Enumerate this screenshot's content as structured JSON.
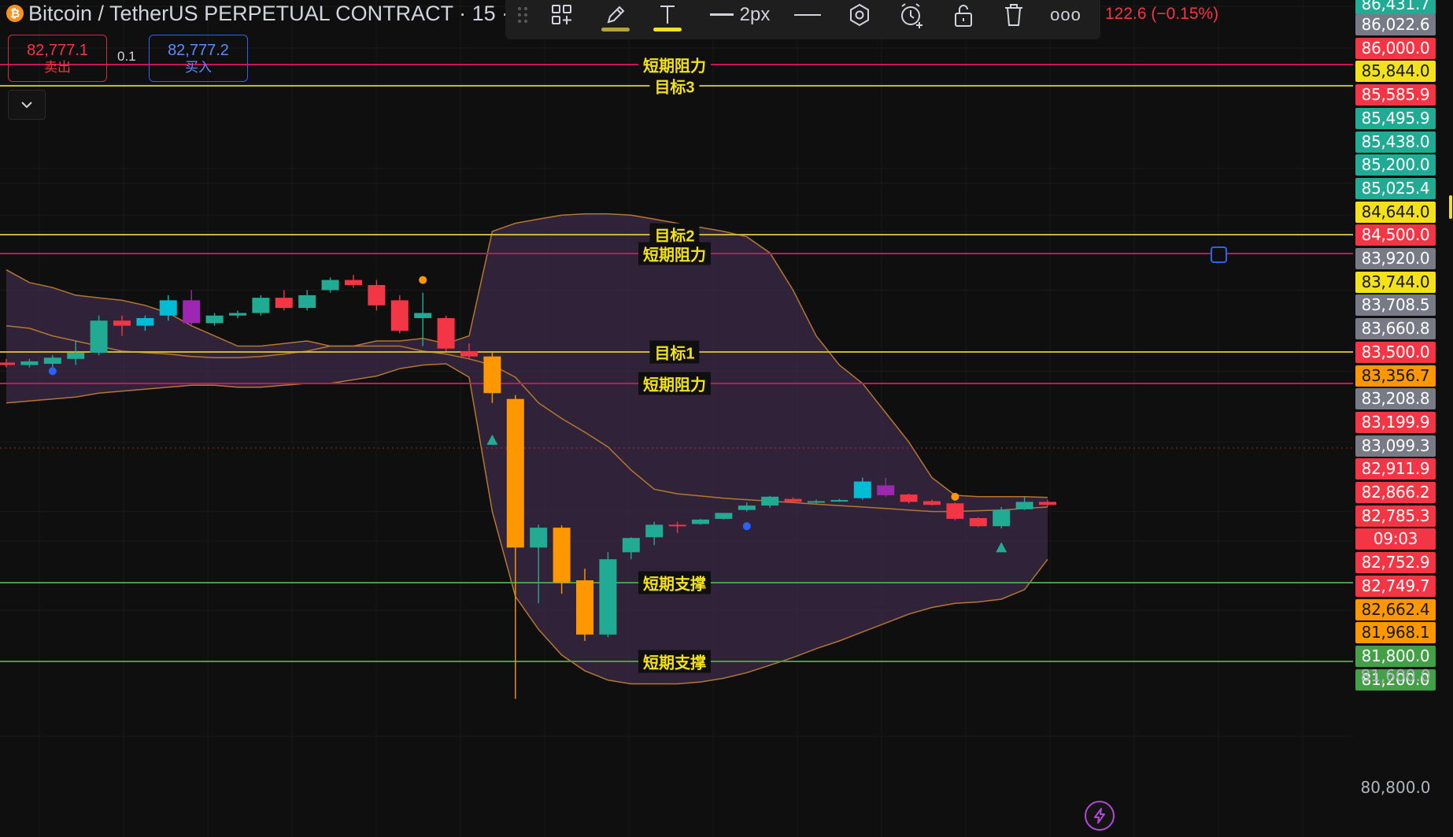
{
  "header": {
    "symbol_title": "Bitcoin / TetherUS PERPETUAL CONTRACT · 15 ·",
    "btc_glyph": "₿",
    "price_change": "122.6 (−0.15%)"
  },
  "toolbar": {
    "line_width_label": "2px",
    "more_label": "ooo",
    "tools": [
      "drag-handle-icon",
      "add-to-layout-icon",
      "pencil-icon",
      "text-icon",
      "line-width-icon",
      "line-style-icon",
      "settings-icon",
      "alert-icon",
      "lock-icon",
      "trash-icon",
      "more-icon"
    ]
  },
  "trade_panel": {
    "sell_price": "82,777.1",
    "sell_label": "卖出",
    "spread": "0.1",
    "buy_price": "82,777.2",
    "buy_label": "买入"
  },
  "colors": {
    "up": "#22ab94",
    "down": "#f23645",
    "orange": "#ff9800",
    "cyan": "#00bcd4",
    "purple": "#9c27b0",
    "band_fill": "#3d2b4a",
    "band_line": "#b5762f",
    "resistance": "#c2185b",
    "target": "#c6b43a",
    "support": "#43a047"
  },
  "levels": [
    {
      "label": "短期阻力",
      "price": 85844.0,
      "color": "#c2185b"
    },
    {
      "label": "目标3",
      "price": 85438.0,
      "color": "#c6b43a"
    },
    {
      "label": "目标2",
      "price": 83920.0,
      "color": "#c6b43a"
    },
    {
      "label": "短期阻力",
      "price": 83744.0,
      "color": "#c2185b"
    },
    {
      "label": "目标1",
      "price": 83356.7,
      "color": "#c6b43a"
    },
    {
      "label": "短期阻力",
      "price": 83099.3,
      "color": "#c2185b"
    },
    {
      "label": "短期支撑",
      "price": 81800.0,
      "color": "#43a047"
    },
    {
      "label": "短期支撑",
      "price": 81200.0,
      "color": "#43a047"
    }
  ],
  "price_axis": {
    "tags": [
      {
        "text": "86,431.7",
        "bg": "#22ab94",
        "fg": "#ffffff",
        "price": 86431.7
      },
      {
        "text": "86,022.6",
        "bg": "#787b86",
        "fg": "#ffffff",
        "price": 86022.6
      },
      {
        "text": "86,000.0",
        "bg": "#f23645",
        "fg": "#ffffff",
        "price": 86000.0
      },
      {
        "text": "85,844.0",
        "bg": "#f3e11a",
        "fg": "#131722",
        "price": 85844.0
      },
      {
        "text": "85,585.9",
        "bg": "#f23645",
        "fg": "#ffffff",
        "price": 85585.9
      },
      {
        "text": "85,495.9",
        "bg": "#22ab94",
        "fg": "#ffffff",
        "price": 85495.9
      },
      {
        "text": "85,438.0",
        "bg": "#22ab94",
        "fg": "#ffffff",
        "price": 85438.0
      },
      {
        "text": "85,200.0",
        "bg": "#22ab94",
        "fg": "#ffffff",
        "price": 85200.0
      },
      {
        "text": "85,025.4",
        "bg": "#22ab94",
        "fg": "#ffffff",
        "price": 85025.4
      },
      {
        "text": "84,644.0",
        "bg": "#f3e11a",
        "fg": "#131722",
        "price": 84644.0
      },
      {
        "text": "84,500.0",
        "bg": "#f23645",
        "fg": "#ffffff",
        "price": 84500.0
      },
      {
        "text": "83,920.0",
        "bg": "#787b86",
        "fg": "#ffffff",
        "price": 83920.0
      },
      {
        "text": "83,744.0",
        "bg": "#f3e11a",
        "fg": "#131722",
        "price": 83744.0
      },
      {
        "text": "83,708.5",
        "bg": "#787b86",
        "fg": "#ffffff",
        "price": 83708.5
      },
      {
        "text": "83,660.8",
        "bg": "#787b86",
        "fg": "#ffffff",
        "price": 83660.8
      },
      {
        "text": "83,500.0",
        "bg": "#f23645",
        "fg": "#ffffff",
        "price": 83500.0
      },
      {
        "text": "83,356.7",
        "bg": "#ff9800",
        "fg": "#131722",
        "price": 83356.7
      },
      {
        "text": "83,208.8",
        "bg": "#787b86",
        "fg": "#ffffff",
        "price": 83208.8
      },
      {
        "text": "83,199.9",
        "bg": "#f23645",
        "fg": "#ffffff",
        "price": 83199.9
      },
      {
        "text": "83,099.3",
        "bg": "#787b86",
        "fg": "#ffffff",
        "price": 83099.3
      },
      {
        "text": "82,911.9",
        "bg": "#f23645",
        "fg": "#ffffff",
        "price": 82911.9
      },
      {
        "text": "82,866.2",
        "bg": "#f23645",
        "fg": "#ffffff",
        "price": 82866.2
      },
      {
        "text": "82,785.3",
        "bg": "#f23645",
        "fg": "#ffffff",
        "price": 82785.3
      },
      {
        "text": "09:03",
        "bg": "#f23645",
        "fg": "#ffffff",
        "price": 82768.0
      },
      {
        "text": "82,752.9",
        "bg": "#f23645",
        "fg": "#ffffff",
        "price": 82752.9
      },
      {
        "text": "82,749.7",
        "bg": "#f23645",
        "fg": "#ffffff",
        "price": 82749.7
      },
      {
        "text": "82,662.4",
        "bg": "#ff9800",
        "fg": "#131722",
        "price": 82662.4
      },
      {
        "text": "81,968.1",
        "bg": "#ff9800",
        "fg": "#131722",
        "price": 81968.1
      },
      {
        "text": "81,800.0",
        "bg": "#43a047",
        "fg": "#ffffff",
        "price": 81800.0
      },
      {
        "text": "81,200.0",
        "bg": "#43a047",
        "fg": "#ffffff",
        "price": 81200.0
      }
    ],
    "plain_ticks": [
      {
        "text": "81,600.0",
        "price": 81600
      },
      {
        "text": "80,800.0",
        "price": 80800
      }
    ]
  },
  "chart_data": {
    "type": "candlestick",
    "symbol": "Bitcoin / TetherUS PERPETUAL CONTRACT",
    "interval": "15",
    "ylim": [
      80600,
      86500
    ],
    "current_price": 82777.1,
    "candles": [
      {
        "o": 83250,
        "h": 83300,
        "l": 83230,
        "c": 83270,
        "color": "down"
      },
      {
        "o": 83250,
        "h": 83300,
        "l": 83230,
        "c": 83280,
        "color": "up"
      },
      {
        "o": 83260,
        "h": 83330,
        "l": 83230,
        "c": 83310,
        "color": "up"
      },
      {
        "o": 83300,
        "h": 83400,
        "l": 83250,
        "c": 83350,
        "color": "up"
      },
      {
        "o": 83350,
        "h": 83500,
        "l": 83330,
        "c": 83480,
        "color": "up"
      },
      {
        "o": 83460,
        "h": 83500,
        "l": 83420,
        "c": 83480,
        "color": "down"
      },
      {
        "o": 83460,
        "h": 83500,
        "l": 83440,
        "c": 83490,
        "color": "cyan"
      },
      {
        "o": 83500,
        "h": 83580,
        "l": 83480,
        "c": 83560,
        "color": "cyan"
      },
      {
        "o": 83560,
        "h": 83600,
        "l": 83460,
        "c": 83470,
        "color": "purple"
      },
      {
        "o": 83470,
        "h": 83510,
        "l": 83460,
        "c": 83500,
        "color": "up"
      },
      {
        "o": 83500,
        "h": 83520,
        "l": 83490,
        "c": 83510,
        "color": "up"
      },
      {
        "o": 83510,
        "h": 83580,
        "l": 83500,
        "c": 83570,
        "color": "up"
      },
      {
        "o": 83570,
        "h": 83600,
        "l": 83520,
        "c": 83530,
        "color": "down"
      },
      {
        "o": 83530,
        "h": 83600,
        "l": 83520,
        "c": 83580,
        "color": "up"
      },
      {
        "o": 83600,
        "h": 83650,
        "l": 83590,
        "c": 83640,
        "color": "up"
      },
      {
        "o": 83640,
        "h": 83660,
        "l": 83610,
        "c": 83620,
        "color": "down"
      },
      {
        "o": 83620,
        "h": 83640,
        "l": 83520,
        "c": 83540,
        "color": "down"
      },
      {
        "o": 83560,
        "h": 83580,
        "l": 83430,
        "c": 83440,
        "color": "down"
      },
      {
        "o": 83490,
        "h": 83590,
        "l": 83380,
        "c": 83510,
        "color": "up"
      },
      {
        "o": 83490,
        "h": 83500,
        "l": 83360,
        "c": 83370,
        "color": "down"
      },
      {
        "o": 83360,
        "h": 83390,
        "l": 83300,
        "c": 83320,
        "color": "down"
      },
      {
        "o": 83320,
        "h": 83350,
        "l": 83000,
        "c": 83050,
        "color": "orange"
      },
      {
        "o": 83020,
        "h": 83040,
        "l": 81000,
        "c": 81950,
        "color": "orange"
      },
      {
        "o": 81950,
        "h": 82220,
        "l": 81650,
        "c": 82180,
        "color": "up"
      },
      {
        "o": 82180,
        "h": 82210,
        "l": 81720,
        "c": 81800,
        "color": "orange"
      },
      {
        "o": 81810,
        "h": 81860,
        "l": 81360,
        "c": 81410,
        "color": "orange"
      },
      {
        "o": 81410,
        "h": 81930,
        "l": 81390,
        "c": 81900,
        "color": "up"
      },
      {
        "o": 81930,
        "h": 82050,
        "l": 81900,
        "c": 82040,
        "color": "up"
      },
      {
        "o": 82050,
        "h": 82260,
        "l": 81960,
        "c": 82220,
        "color": "up"
      },
      {
        "o": 82220,
        "h": 82260,
        "l": 82110,
        "c": 82200,
        "color": "down"
      },
      {
        "o": 82230,
        "h": 82300,
        "l": 82220,
        "c": 82290,
        "color": "up"
      },
      {
        "o": 82300,
        "h": 82380,
        "l": 82290,
        "c": 82380,
        "color": "up"
      },
      {
        "o": 82480,
        "h": 82520,
        "l": 82400,
        "c": 82420,
        "color": "up"
      },
      {
        "o": 82480,
        "h": 82610,
        "l": 82450,
        "c": 82600,
        "color": "up"
      },
      {
        "o": 82570,
        "h": 82590,
        "l": 82520,
        "c": 82530,
        "color": "down"
      },
      {
        "o": 82530,
        "h": 82560,
        "l": 82510,
        "c": 82540,
        "color": "up"
      },
      {
        "o": 82550,
        "h": 82570,
        "l": 82530,
        "c": 82555,
        "color": "up"
      },
      {
        "o": 82580,
        "h": 82700,
        "l": 82560,
        "c": 82690,
        "color": "cyan"
      },
      {
        "o": 82680,
        "h": 82700,
        "l": 82600,
        "c": 82620,
        "color": "purple"
      },
      {
        "o": 82630,
        "h": 82640,
        "l": 82510,
        "c": 82530,
        "color": "down"
      },
      {
        "o": 82540,
        "h": 82560,
        "l": 82480,
        "c": 82490,
        "color": "down"
      },
      {
        "o": 82510,
        "h": 82520,
        "l": 82280,
        "c": 82300,
        "color": "down"
      },
      {
        "o": 82310,
        "h": 82320,
        "l": 82190,
        "c": 82200,
        "color": "down"
      },
      {
        "o": 82200,
        "h": 82460,
        "l": 82170,
        "c": 82420,
        "color": "up"
      },
      {
        "o": 82430,
        "h": 82610,
        "l": 82420,
        "c": 82530,
        "color": "up"
      },
      {
        "o": 82530,
        "h": 82560,
        "l": 82470,
        "c": 82490,
        "color": "down"
      }
    ],
    "bollinger": {
      "upper": [
        83680,
        83630,
        83610,
        83580,
        83570,
        83560,
        83540,
        83510,
        83460,
        83420,
        83380,
        83380,
        83390,
        83400,
        83380,
        83380,
        83400,
        83400,
        83410,
        83390,
        83420,
        84000,
        84200,
        84300,
        84400,
        84430,
        84430,
        84400,
        84300,
        84200,
        84100,
        84000,
        83900,
        83750,
        83600,
        83420,
        83250,
        83100,
        82950,
        82800,
        82700,
        82620,
        82600,
        82600,
        82600,
        82590
      ],
      "basis": [
        83460,
        83450,
        83420,
        83400,
        83380,
        83360,
        83350,
        83340,
        83320,
        83310,
        83310,
        83320,
        83340,
        83360,
        83380,
        83380,
        83380,
        83380,
        83360,
        83340,
        83300,
        83250,
        83150,
        83000,
        82920,
        82850,
        82780,
        82720,
        82670,
        82640,
        82610,
        82580,
        82560,
        82540,
        82520,
        82500,
        82480,
        82460,
        82440,
        82420,
        82400,
        82400,
        82410,
        82420,
        82440,
        82460
      ],
      "lower": [
        83000,
        83010,
        83020,
        83030,
        83050,
        83060,
        83070,
        83080,
        83090,
        83090,
        83080,
        83080,
        83090,
        83100,
        83100,
        83130,
        83160,
        83220,
        83250,
        83260,
        83150,
        82400,
        81700,
        81450,
        81250,
        81150,
        81100,
        81080,
        81080,
        81080,
        81090,
        81110,
        81140,
        81180,
        81230,
        81300,
        81360,
        81430,
        81500,
        81570,
        81620,
        81650,
        81660,
        81680,
        81750,
        81900
      ]
    },
    "markers": [
      {
        "type": "dot",
        "bar": 2,
        "price": 83200,
        "color": "#2962ff"
      },
      {
        "type": "dot",
        "bar": 18,
        "price": 83640,
        "color": "#ff9800"
      },
      {
        "type": "triangle-up",
        "bar": 21,
        "price": 82810,
        "color": "#22ab94"
      },
      {
        "type": "dot",
        "bar": 32,
        "price": 82200,
        "color": "#2962ff"
      },
      {
        "type": "dot",
        "bar": 41,
        "price": 82600,
        "color": "#ff9800"
      },
      {
        "type": "triangle-up",
        "bar": 43,
        "price": 81950,
        "color": "#22ab94"
      }
    ]
  }
}
